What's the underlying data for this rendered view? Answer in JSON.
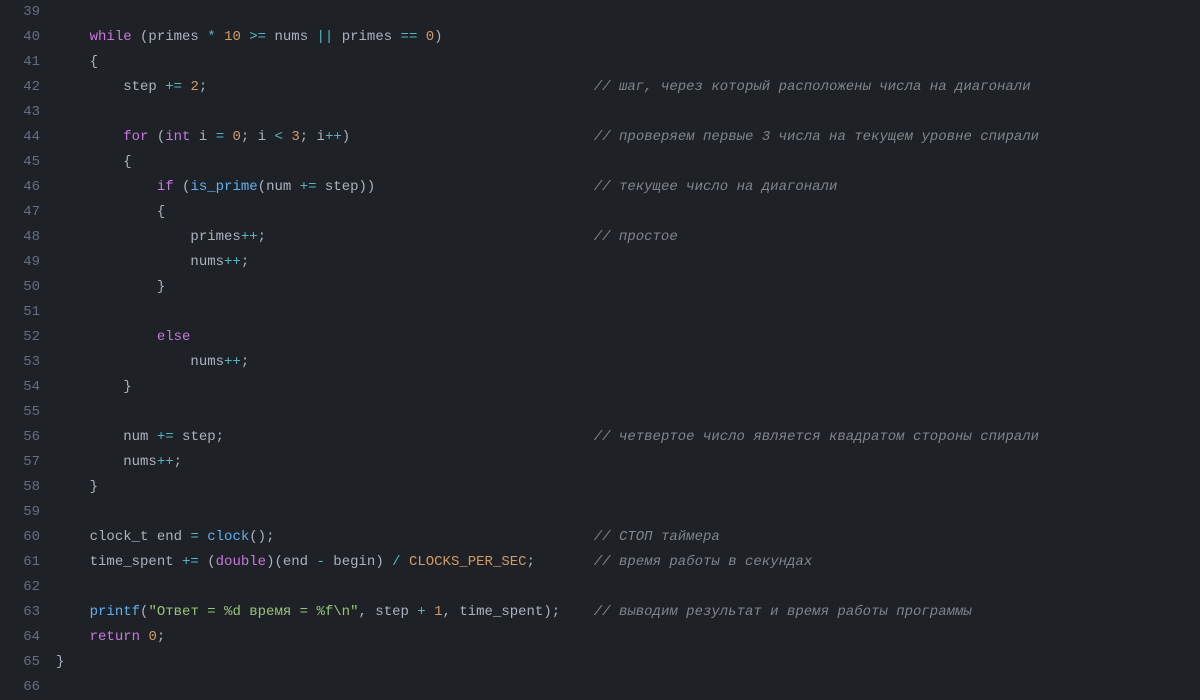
{
  "lineNumbers": [
    "39",
    "40",
    "41",
    "42",
    "43",
    "44",
    "45",
    "46",
    "47",
    "48",
    "49",
    "50",
    "51",
    "52",
    "53",
    "54",
    "55",
    "56",
    "57",
    "58",
    "59",
    "60",
    "61",
    "62",
    "63",
    "64",
    "65",
    "66"
  ],
  "lines": [
    {
      "indent": "    ",
      "tokens": []
    },
    {
      "indent": "    ",
      "tokens": [
        {
          "c": "kw",
          "t": "while"
        },
        {
          "c": "punc",
          "t": " (primes "
        },
        {
          "c": "op",
          "t": "*"
        },
        {
          "c": "punc",
          "t": " "
        },
        {
          "c": "num",
          "t": "10"
        },
        {
          "c": "punc",
          "t": " "
        },
        {
          "c": "op",
          "t": ">="
        },
        {
          "c": "punc",
          "t": " nums "
        },
        {
          "c": "op",
          "t": "||"
        },
        {
          "c": "punc",
          "t": " primes "
        },
        {
          "c": "op",
          "t": "=="
        },
        {
          "c": "punc",
          "t": " "
        },
        {
          "c": "num",
          "t": "0"
        },
        {
          "c": "punc",
          "t": ")"
        }
      ]
    },
    {
      "indent": "    ",
      "tokens": [
        {
          "c": "punc",
          "t": "{"
        }
      ]
    },
    {
      "indent": "        ",
      "tokens": [
        {
          "c": "ident",
          "t": "step "
        },
        {
          "c": "op",
          "t": "+="
        },
        {
          "c": "punc",
          "t": " "
        },
        {
          "c": "num",
          "t": "2"
        },
        {
          "c": "punc",
          "t": ";"
        }
      ],
      "comment": "// шаг, через который расположены числа на диагонали",
      "commentCol": 64
    },
    {
      "indent": "",
      "tokens": []
    },
    {
      "indent": "        ",
      "tokens": [
        {
          "c": "kw",
          "t": "for"
        },
        {
          "c": "punc",
          "t": " ("
        },
        {
          "c": "kw",
          "t": "int"
        },
        {
          "c": "punc",
          "t": " i "
        },
        {
          "c": "op",
          "t": "="
        },
        {
          "c": "punc",
          "t": " "
        },
        {
          "c": "num",
          "t": "0"
        },
        {
          "c": "punc",
          "t": "; i "
        },
        {
          "c": "op",
          "t": "<"
        },
        {
          "c": "punc",
          "t": " "
        },
        {
          "c": "num",
          "t": "3"
        },
        {
          "c": "punc",
          "t": "; i"
        },
        {
          "c": "op",
          "t": "++"
        },
        {
          "c": "punc",
          "t": ")"
        }
      ],
      "comment": "// проверяем первые 3 числа на текущем уровне спирали",
      "commentCol": 64
    },
    {
      "indent": "        ",
      "tokens": [
        {
          "c": "punc",
          "t": "{"
        }
      ]
    },
    {
      "indent": "            ",
      "tokens": [
        {
          "c": "kw",
          "t": "if"
        },
        {
          "c": "punc",
          "t": " ("
        },
        {
          "c": "fn",
          "t": "is_prime"
        },
        {
          "c": "punc",
          "t": "(num "
        },
        {
          "c": "op",
          "t": "+="
        },
        {
          "c": "punc",
          "t": " step))"
        }
      ],
      "comment": "// текущее число на диагонали",
      "commentCol": 64
    },
    {
      "indent": "            ",
      "tokens": [
        {
          "c": "punc",
          "t": "{"
        }
      ]
    },
    {
      "indent": "                ",
      "tokens": [
        {
          "c": "ident",
          "t": "primes"
        },
        {
          "c": "op",
          "t": "++"
        },
        {
          "c": "punc",
          "t": ";"
        }
      ],
      "comment": "// простое",
      "commentCol": 64
    },
    {
      "indent": "                ",
      "tokens": [
        {
          "c": "ident",
          "t": "nums"
        },
        {
          "c": "op",
          "t": "++"
        },
        {
          "c": "punc",
          "t": ";"
        }
      ]
    },
    {
      "indent": "            ",
      "tokens": [
        {
          "c": "punc",
          "t": "}"
        }
      ]
    },
    {
      "indent": "",
      "tokens": []
    },
    {
      "indent": "            ",
      "tokens": [
        {
          "c": "kw",
          "t": "else"
        }
      ]
    },
    {
      "indent": "                ",
      "tokens": [
        {
          "c": "ident",
          "t": "nums"
        },
        {
          "c": "op",
          "t": "++"
        },
        {
          "c": "punc",
          "t": ";"
        }
      ]
    },
    {
      "indent": "        ",
      "tokens": [
        {
          "c": "punc",
          "t": "}"
        }
      ]
    },
    {
      "indent": "",
      "tokens": []
    },
    {
      "indent": "        ",
      "tokens": [
        {
          "c": "ident",
          "t": "num "
        },
        {
          "c": "op",
          "t": "+="
        },
        {
          "c": "punc",
          "t": " step;"
        }
      ],
      "comment": "// четвертое число является квадратом стороны спирали",
      "commentCol": 64
    },
    {
      "indent": "        ",
      "tokens": [
        {
          "c": "ident",
          "t": "nums"
        },
        {
          "c": "op",
          "t": "++"
        },
        {
          "c": "punc",
          "t": ";"
        }
      ]
    },
    {
      "indent": "    ",
      "tokens": [
        {
          "c": "punc",
          "t": "}"
        }
      ]
    },
    {
      "indent": "",
      "tokens": []
    },
    {
      "indent": "    ",
      "tokens": [
        {
          "c": "ident",
          "t": "clock_t end "
        },
        {
          "c": "op",
          "t": "="
        },
        {
          "c": "punc",
          "t": " "
        },
        {
          "c": "fn",
          "t": "clock"
        },
        {
          "c": "punc",
          "t": "();"
        }
      ],
      "comment": "// СТОП таймера",
      "commentCol": 64
    },
    {
      "indent": "    ",
      "tokens": [
        {
          "c": "ident",
          "t": "time_spent "
        },
        {
          "c": "op",
          "t": "+="
        },
        {
          "c": "punc",
          "t": " ("
        },
        {
          "c": "kw",
          "t": "double"
        },
        {
          "c": "punc",
          "t": ")(end "
        },
        {
          "c": "op",
          "t": "-"
        },
        {
          "c": "punc",
          "t": " begin) "
        },
        {
          "c": "op",
          "t": "/"
        },
        {
          "c": "punc",
          "t": " "
        },
        {
          "c": "const",
          "t": "CLOCKS_PER_SEC"
        },
        {
          "c": "punc",
          "t": ";"
        }
      ],
      "comment": "// время работы в секундах",
      "commentCol": 64
    },
    {
      "indent": "",
      "tokens": []
    },
    {
      "indent": "    ",
      "tokens": [
        {
          "c": "fn",
          "t": "printf"
        },
        {
          "c": "punc",
          "t": "("
        },
        {
          "c": "str",
          "t": "\"Ответ = %d время = %f\\n\""
        },
        {
          "c": "punc",
          "t": ", step "
        },
        {
          "c": "op",
          "t": "+"
        },
        {
          "c": "punc",
          "t": " "
        },
        {
          "c": "num",
          "t": "1"
        },
        {
          "c": "punc",
          "t": ", time_spent);"
        }
      ],
      "comment": "// выводим результат и время работы программы",
      "commentCol": 64
    },
    {
      "indent": "    ",
      "tokens": [
        {
          "c": "kw",
          "t": "return"
        },
        {
          "c": "punc",
          "t": " "
        },
        {
          "c": "num",
          "t": "0"
        },
        {
          "c": "punc",
          "t": ";"
        }
      ]
    },
    {
      "indent": "",
      "tokens": [
        {
          "c": "punc",
          "t": "}"
        }
      ]
    },
    {
      "indent": "",
      "tokens": []
    }
  ]
}
